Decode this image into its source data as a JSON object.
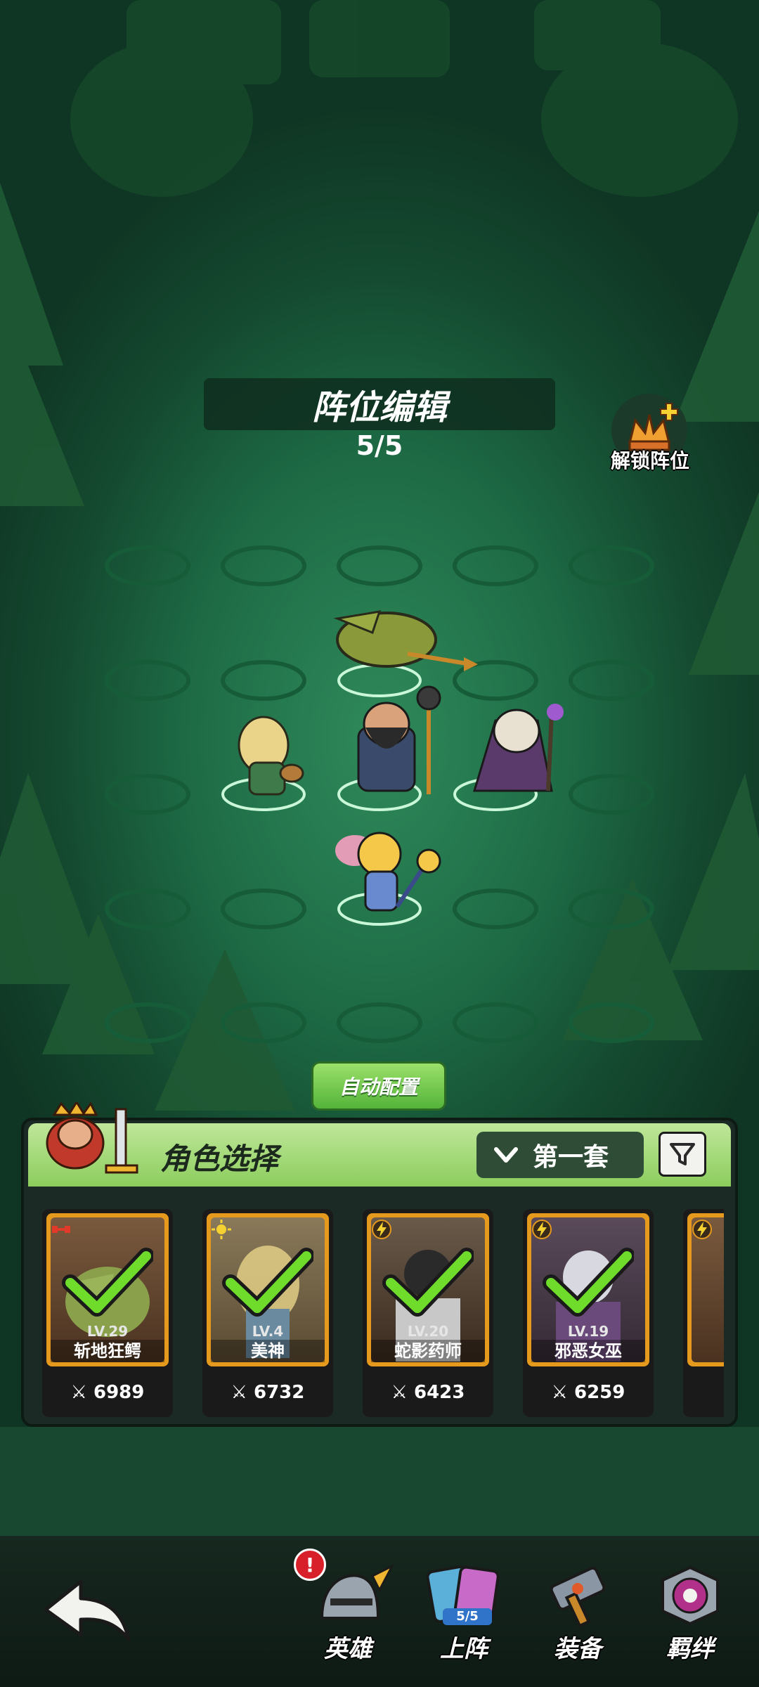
{
  "formation": {
    "title": "阵位编辑",
    "count": "5/5",
    "unlock_label": "解锁阵位",
    "auto_button": "自动配置"
  },
  "selection_panel": {
    "title": "角色选择",
    "set_selected": "第一套",
    "cards": [
      {
        "level": "LV.29",
        "name": "斩地狂鳄",
        "power": "6989",
        "selected": true
      },
      {
        "level": "LV.4",
        "name": "美神",
        "power": "6732",
        "selected": true
      },
      {
        "level": "LV.20",
        "name": "蛇影药师",
        "power": "6423",
        "selected": true
      },
      {
        "level": "LV.19",
        "name": "邪恶女巫",
        "power": "6259",
        "selected": true
      }
    ]
  },
  "nav": {
    "heroes": "英雄",
    "deploy": "上阵",
    "deploy_count": "5/5",
    "equipment": "装备",
    "bonds": "羁绊",
    "heroes_alert": "!"
  },
  "colors": {
    "accent_green": "#54b43a",
    "check_green": "#6fdc2c",
    "card_frame": "#e59a1e",
    "alert_red": "#d8202a"
  }
}
